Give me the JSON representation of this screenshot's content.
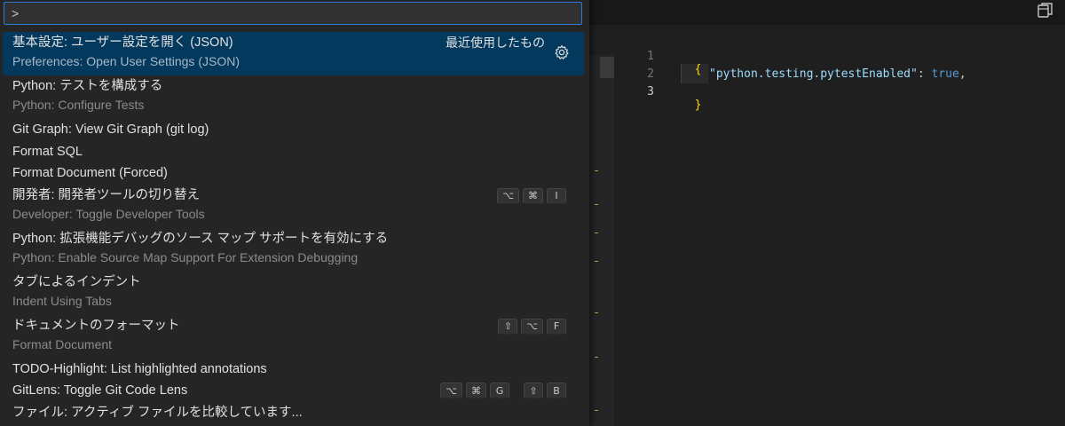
{
  "palette": {
    "query": ">",
    "items": [
      {
        "label": "基本設定: ユーザー設定を開く (JSON)",
        "detail": "Preferences: Open User Settings (JSON)",
        "right": "最近使用したもの",
        "selected": true
      },
      {
        "label": "Python: テストを構成する",
        "detail": "Python: Configure Tests"
      },
      {
        "label": "Git Graph: View Git Graph (git log)"
      },
      {
        "label": "Format SQL"
      },
      {
        "label": "Format Document (Forced)"
      },
      {
        "label": "開発者: 開発者ツールの切り替え",
        "detail": "Developer: Toggle Developer Tools",
        "keys": [
          "⌥",
          "⌘",
          "I"
        ]
      },
      {
        "label": "Python: 拡張機能デバッグのソース マップ サポートを有効にする",
        "detail": "Python: Enable Source Map Support For Extension Debugging"
      },
      {
        "label": "タブによるインデント",
        "detail": "Indent Using Tabs"
      },
      {
        "label": "ドキュメントのフォーマット",
        "detail": "Format Document",
        "keys": [
          "⇧",
          "⌥",
          "F"
        ]
      },
      {
        "label": "TODO-Highlight: List highlighted annotations"
      },
      {
        "label": "GitLens: Toggle Git Code Lens",
        "keys": [
          "⌥",
          "⌘",
          "G"
        ],
        "keys2": [
          "⇧",
          "B"
        ]
      },
      {
        "label": "ファイル: アクティブ ファイルを比較しています..."
      }
    ]
  },
  "editor": {
    "line_numbers": [
      "1",
      "2",
      "3"
    ],
    "code": {
      "open_brace": "{",
      "key": "\"python.testing.pytestEnabled\"",
      "colon": ": ",
      "value": "true",
      "comma": ",",
      "close_brace": "}"
    }
  },
  "icons": {
    "gear": "gear-icon",
    "split": "split-editor-icon"
  },
  "colors": {
    "selection": "#04395e",
    "focus_border": "#2f79d4",
    "brace": "#ffd700",
    "json_key": "#9cdcfe",
    "json_bool": "#569cd6"
  }
}
